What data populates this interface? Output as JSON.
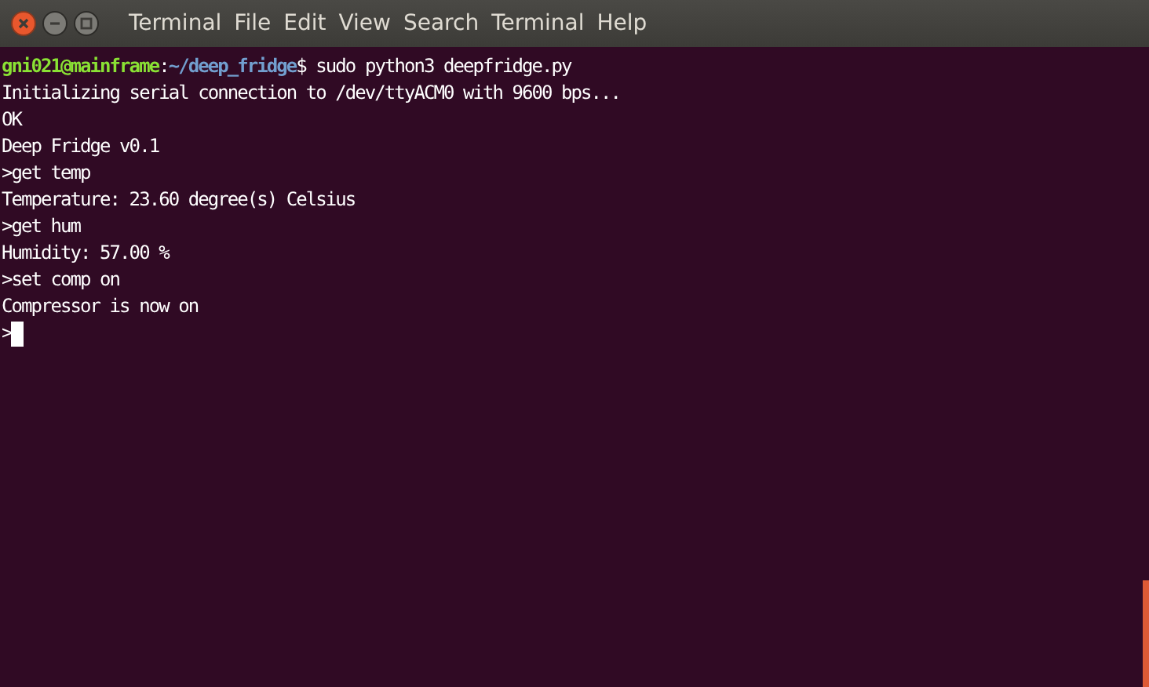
{
  "window": {
    "title": "Terminal"
  },
  "menu": [
    "File",
    "Edit",
    "View",
    "Search",
    "Terminal",
    "Help"
  ],
  "terminal": {
    "prompt": {
      "user_host": "gni021@mainframe",
      "separator": ":",
      "path": "~/deep_fridge",
      "symbol": "$",
      "command": " sudo python3 deepfridge.py"
    },
    "lines": [
      "Initializing serial connection to /dev/ttyACM0 with 9600 bps...",
      "OK",
      "Deep Fridge v0.1",
      ">get temp",
      "Temperature: 23.60 degree(s) Celsius",
      ">get hum",
      "Humidity: 57.00 %",
      ">set comp on",
      "Compressor is now on"
    ],
    "input_prompt": ">"
  }
}
